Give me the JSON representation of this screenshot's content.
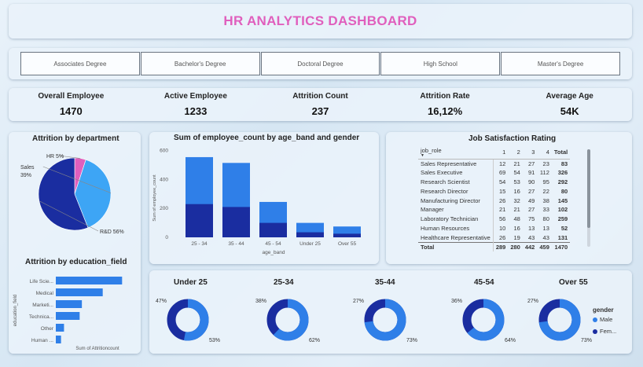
{
  "dashboard": {
    "title": "HR ANALYTICS DASHBOARD"
  },
  "slicer": {
    "items": [
      "Associates Degree",
      "Bachelor's Degree",
      "Doctoral Degree",
      "High School",
      "Master's Degree"
    ]
  },
  "kpis": [
    {
      "label": "Overall Employee",
      "value": "1470"
    },
    {
      "label": "Active Employee",
      "value": "1233"
    },
    {
      "label": "Attrition Count",
      "value": "237"
    },
    {
      "label": "Attrition Rate",
      "value": "16,12%"
    },
    {
      "label": "Average Age",
      "value": "54K"
    }
  ],
  "colors": {
    "dark": "#1a2da0",
    "mid": "#2f7fe8",
    "light": "#3da5f5",
    "pink": "#e05fbd"
  },
  "department": {
    "title": "Attrition by department",
    "chart_data": {
      "type": "pie",
      "labels": [
        "HR",
        "Sales",
        "R&D"
      ],
      "values": [
        5,
        39,
        56
      ],
      "data_labels": [
        "HR 5%",
        "Sales 39%",
        "R&D 56%"
      ]
    }
  },
  "education": {
    "title": "Attrition by education_field",
    "ylabel": "education_field",
    "xlabel": "Sum of Attritioncount",
    "chart_data": {
      "type": "bar",
      "orientation": "horizontal",
      "categories": [
        "Life Scie...",
        "Medical",
        "Marketi...",
        "Technica...",
        "Other",
        "Human ..."
      ],
      "values": [
        89,
        63,
        35,
        32,
        11,
        7
      ],
      "xlim": [
        0,
        95
      ]
    }
  },
  "age_band": {
    "title": "Sum of employee_count by age_band and gender",
    "xlabel": "age_band",
    "ylabel": "Sum of employee_count",
    "chart_data": {
      "type": "bar",
      "stacked": true,
      "categories": [
        "25 - 34",
        "35 - 44",
        "45 - 54",
        "Under 25",
        "Over 55"
      ],
      "series": [
        {
          "name": "Female",
          "values": [
            230,
            210,
            100,
            35,
            25
          ]
        },
        {
          "name": "Male",
          "values": [
            325,
            305,
            145,
            65,
            50
          ]
        }
      ],
      "yticks": [
        "0",
        "200",
        "400",
        "600"
      ],
      "ylim": [
        0,
        620
      ]
    }
  },
  "job": {
    "title": "Job Satisfaction Rating",
    "columns": [
      "job_role",
      "1",
      "2",
      "3",
      "4",
      "Total"
    ],
    "rows": [
      [
        "Sales Representative",
        "12",
        "21",
        "27",
        "23",
        "83"
      ],
      [
        "Sales Executive",
        "69",
        "54",
        "91",
        "112",
        "326"
      ],
      [
        "Research Scientist",
        "54",
        "53",
        "90",
        "95",
        "292"
      ],
      [
        "Research Director",
        "15",
        "16",
        "27",
        "22",
        "80"
      ],
      [
        "Manufacturing Director",
        "26",
        "32",
        "49",
        "38",
        "145"
      ],
      [
        "Manager",
        "21",
        "21",
        "27",
        "33",
        "102"
      ],
      [
        "Laboratory Technician",
        "56",
        "48",
        "75",
        "80",
        "259"
      ],
      [
        "Human Resources",
        "10",
        "16",
        "13",
        "13",
        "52"
      ],
      [
        "Healthcare Representative",
        "26",
        "19",
        "43",
        "43",
        "131"
      ]
    ],
    "total_row": [
      "Total",
      "289",
      "280",
      "442",
      "459",
      "1470"
    ]
  },
  "gender_donuts": {
    "legend_title": "gender",
    "legend": [
      "Male",
      "Fem..."
    ],
    "items": [
      {
        "title": "Under 25",
        "chart_data": {
          "type": "pie",
          "labels": [
            "Male",
            "Female"
          ],
          "values": [
            53,
            47
          ],
          "data_labels": [
            "53%",
            "47%"
          ]
        }
      },
      {
        "title": "25-34",
        "chart_data": {
          "type": "pie",
          "labels": [
            "Male",
            "Female"
          ],
          "values": [
            62,
            38
          ],
          "data_labels": [
            "62%",
            "38%"
          ]
        }
      },
      {
        "title": "35-44",
        "chart_data": {
          "type": "pie",
          "labels": [
            "Male",
            "Female"
          ],
          "values": [
            73,
            27
          ],
          "data_labels": [
            "73%",
            "27%"
          ]
        }
      },
      {
        "title": "45-54",
        "chart_data": {
          "type": "pie",
          "labels": [
            "Male",
            "Female"
          ],
          "values": [
            64,
            36
          ],
          "data_labels": [
            "64%",
            "36%"
          ]
        }
      },
      {
        "title": "Over 55",
        "chart_data": {
          "type": "pie",
          "labels": [
            "Male",
            "Female"
          ],
          "values": [
            73,
            27
          ],
          "data_labels": [
            "73%",
            "27%"
          ]
        }
      }
    ]
  }
}
